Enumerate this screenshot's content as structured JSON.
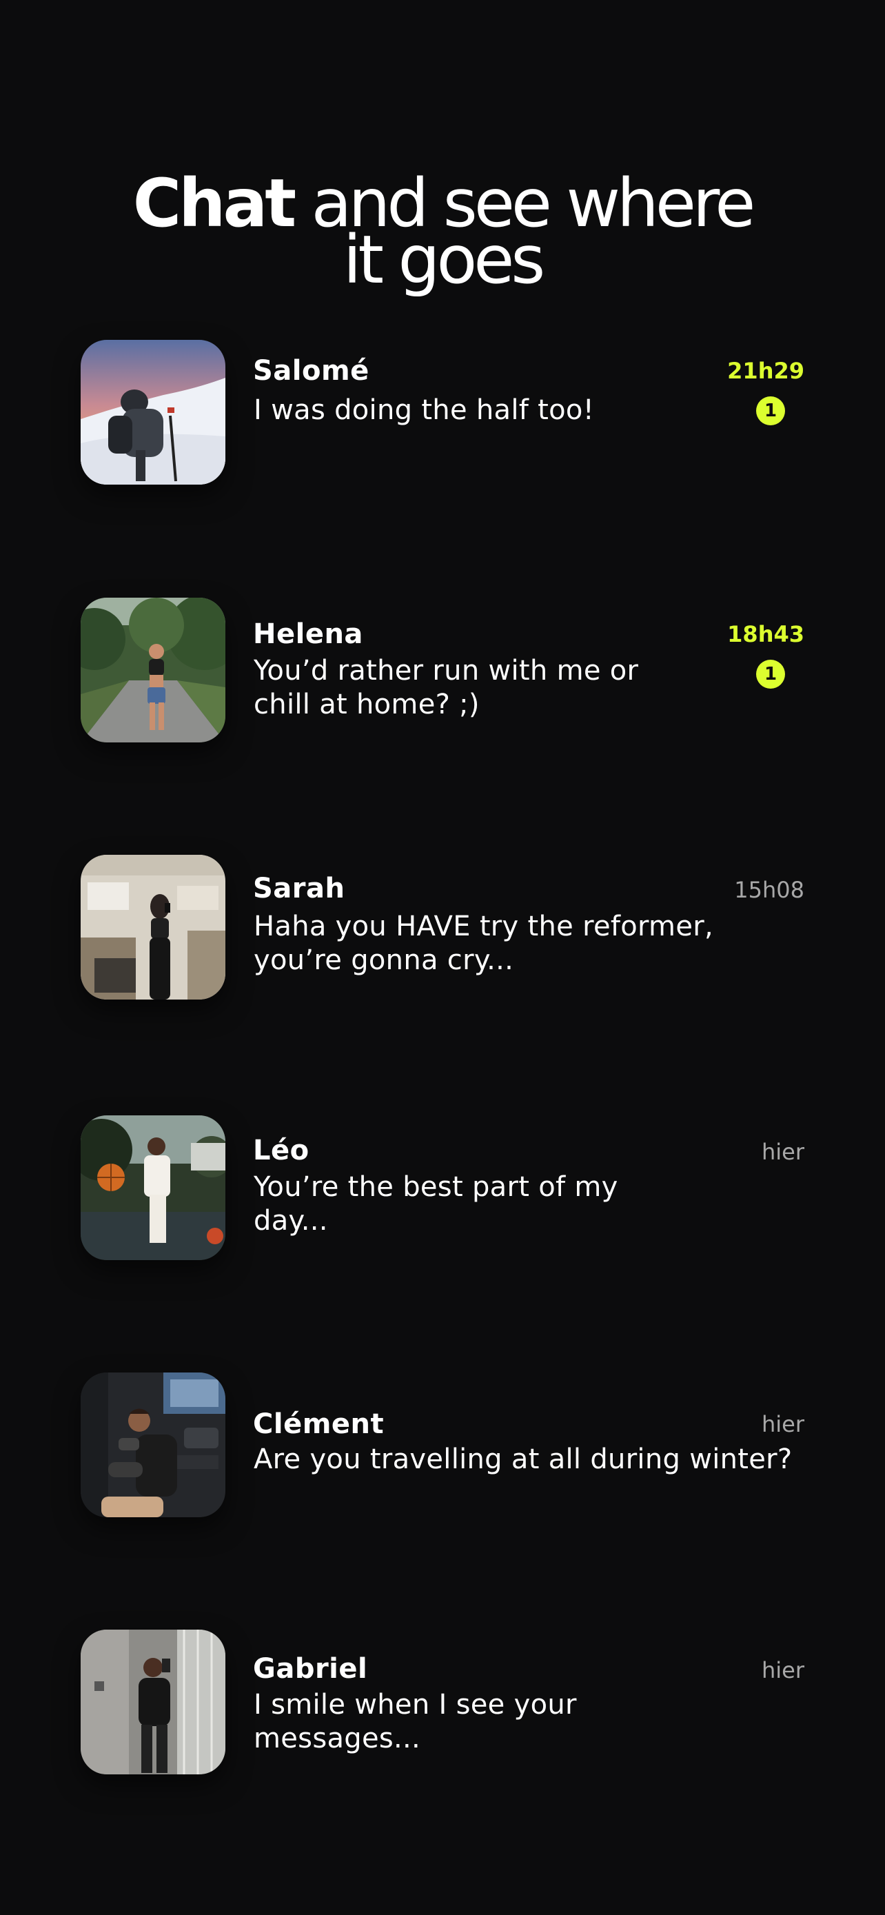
{
  "headline": {
    "bold_word": "Chat",
    "rest_line1": "and see where",
    "line2": "it goes"
  },
  "colors": {
    "background": "#0c0c0d",
    "accent": "#dcff2f",
    "text": "#ffffff",
    "muted": "#a8a8a8"
  },
  "chats": [
    {
      "name": "Salomé",
      "message": "I was doing the half too!",
      "time": "21h29",
      "unread": true,
      "unread_count": "1",
      "avatar_icon": "hiker-on-snow-photo"
    },
    {
      "name": "Helena",
      "message": "You’d rather run with me or chill at home? ;)",
      "time": "18h43",
      "unread": true,
      "unread_count": "1",
      "avatar_icon": "runner-on-forest-road-photo"
    },
    {
      "name": "Sarah",
      "message": "Haha you HAVE try the reformer, you’re gonna cry...",
      "time": "15h08",
      "unread": false,
      "avatar_icon": "pilates-studio-selfie-photo"
    },
    {
      "name": "Léo",
      "message": "You’re the best part of my day...",
      "time": "hier",
      "unread": false,
      "avatar_icon": "basketball-player-photo"
    },
    {
      "name": "Clément",
      "message": "Are you travelling at all during winter?",
      "time": "hier",
      "unread": false,
      "avatar_icon": "gym-workout-photo"
    },
    {
      "name": "Gabriel",
      "message": "I smile when I see your messages...",
      "time": "hier",
      "unread": false,
      "avatar_icon": "mirror-selfie-photo"
    }
  ]
}
